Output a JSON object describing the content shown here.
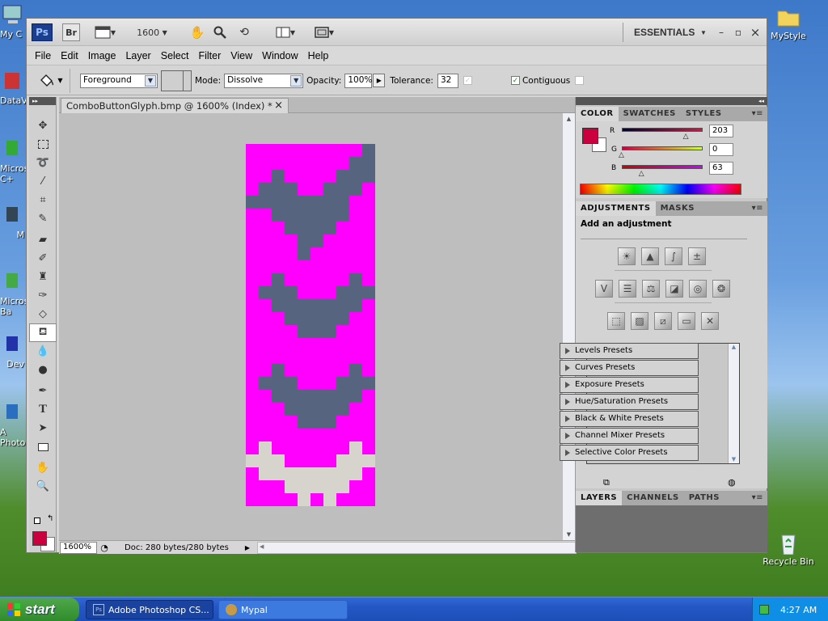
{
  "desktop": {
    "left_labels": [
      "My C",
      "DataV",
      "Micros C+",
      "M",
      "Micros Ba",
      "Dev",
      "A Photo"
    ],
    "right_icons": [
      {
        "label": "MyStyle"
      },
      {
        "label": "Recycle Bin"
      }
    ]
  },
  "titlebar": {
    "ps_logo": "Ps",
    "br_logo": "Br",
    "zoom_level": "1600",
    "workspace": "ESSENTIALS",
    "minimize": "–",
    "maximize": "▫",
    "close": "×"
  },
  "menu": [
    "File",
    "Edit",
    "Image",
    "Layer",
    "Select",
    "Filter",
    "View",
    "Window",
    "Help"
  ],
  "options": {
    "fill_source": "Foreground",
    "mode_label": "Mode:",
    "mode_value": "Dissolve",
    "opacity_label": "Opacity:",
    "opacity_value": "100%",
    "tolerance_label": "Tolerance:",
    "tolerance_value": "32",
    "contiguous_label": "Contiguous",
    "contiguous_checked": true
  },
  "document": {
    "tab_title": "ComboButtonGlyph.bmp @ 1600% (Index) *",
    "tab_close": "×",
    "magenta": "#ff00ff",
    "slate": "#56647f",
    "light": "#d7d4cd",
    "status_zoom": "1600%",
    "status_doc": "Doc: 280 bytes/280 bytes"
  },
  "color_panel": {
    "tabs": [
      "COLOR",
      "SWATCHES",
      "STYLES"
    ],
    "foreground": "#cb003f",
    "background": "#ffffff",
    "channels": [
      {
        "label": "R",
        "value": "203",
        "fraction": 0.796
      },
      {
        "label": "G",
        "value": "0",
        "fraction": 0.0
      },
      {
        "label": "B",
        "value": "63",
        "fraction": 0.247
      }
    ]
  },
  "adjustments_panel": {
    "tabs": [
      "ADJUSTMENTS",
      "MASKS"
    ],
    "heading": "Add an adjustment",
    "presets": [
      "Levels Presets",
      "Curves Presets",
      "Exposure Presets",
      "Hue/Saturation Presets",
      "Black & White Presets",
      "Channel Mixer Presets",
      "Selective Color Presets"
    ]
  },
  "layers_panel": {
    "tabs": [
      "LAYERS",
      "CHANNELS",
      "PATHS"
    ]
  },
  "taskbar": {
    "start": "start",
    "tasks": [
      {
        "label": "Adobe Photoshop CS..."
      },
      {
        "label": "Mypal"
      }
    ],
    "clock": "4:27 AM"
  }
}
